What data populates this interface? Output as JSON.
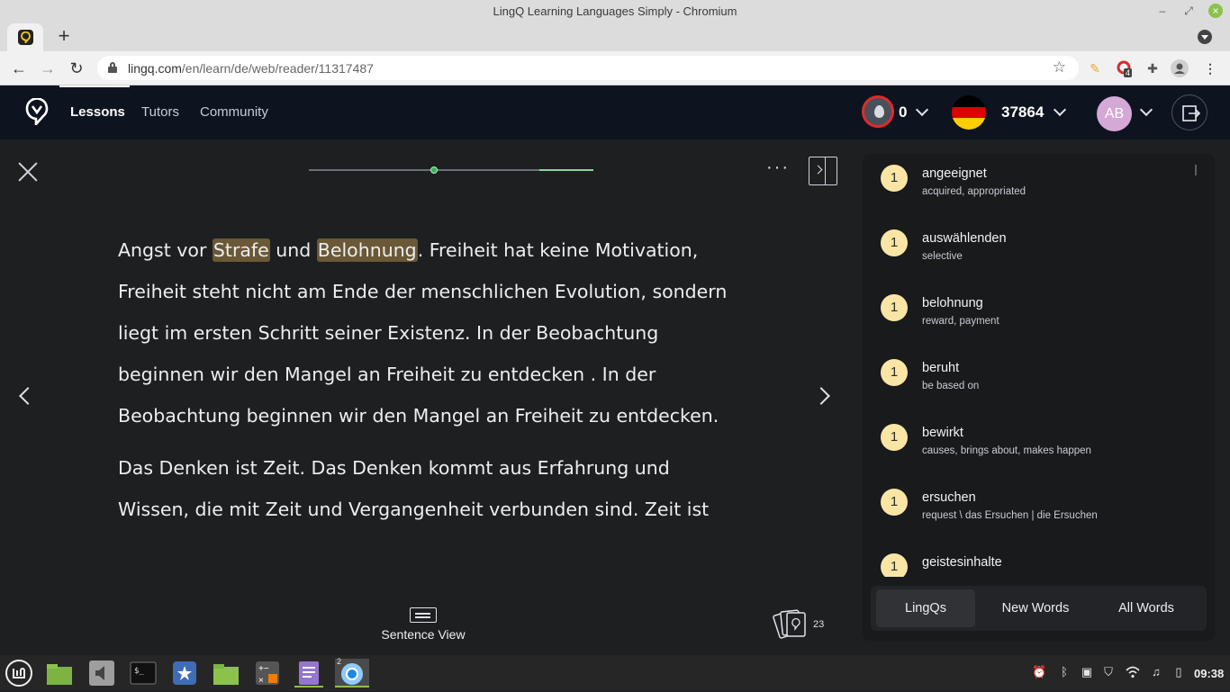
{
  "window": {
    "title": "LingQ Learning Languages Simply - Chromium",
    "minimize": "–",
    "maximize": "⤢",
    "close": "×"
  },
  "browser": {
    "new_tab": "+",
    "url_host": "lingq.com",
    "url_path": "/en/learn/de/web/reader/11317487",
    "ext_badge": "4"
  },
  "header": {
    "nav": [
      "Lessons",
      "Tutors",
      "Community"
    ],
    "streak": "0",
    "coins": "37864",
    "avatar_initials": "AB",
    "flag_colors": [
      "#000000",
      "#dd0000",
      "#ffce00"
    ]
  },
  "reader": {
    "progress_fraction": 0.44,
    "more": "···",
    "paragraphs": [
      [
        {
          "t": "Angst vor "
        },
        {
          "t": "Strafe",
          "lingq": true
        },
        {
          "t": " und "
        },
        {
          "t": "Belohnung",
          "lingq": true
        },
        {
          "t": ". Freiheit hat keine Motivation, Freiheit steht nicht am Ende der menschlichen Evolution, sondern liegt im ersten Schritt seiner Existenz. In der Beobachtung beginnen wir den Mangel an Freiheit zu entdecken . In der Beobachtung beginnen wir den Mangel an Freiheit zu entdecken."
        }
      ],
      [
        {
          "t": "Das Denken ist Zeit. Das Denken kommt aus Erfahrung und Wissen, die mit Zeit und Vergangenheit verbunden sind. Zeit ist"
        }
      ]
    ],
    "sentence_view_label": "Sentence View",
    "cards_count": "23"
  },
  "panel": {
    "words": [
      {
        "status": "1",
        "term": "angeeignet",
        "hint": "acquired, appropriated"
      },
      {
        "status": "1",
        "term": "auswählenden",
        "hint": "selective"
      },
      {
        "status": "1",
        "term": "belohnung",
        "hint": "reward, payment"
      },
      {
        "status": "1",
        "term": "beruht",
        "hint": "be based on"
      },
      {
        "status": "1",
        "term": "bewirkt",
        "hint": "causes, brings about, makes happen"
      },
      {
        "status": "1",
        "term": "ersuchen",
        "hint": "request \\ das Ersuchen | die Ersuchen"
      },
      {
        "status": "1",
        "term": "geistesinhalte",
        "hint": ""
      }
    ],
    "tabs": {
      "lingqs": "LingQs",
      "new_words": "New Words",
      "all_words": "All Words"
    }
  },
  "taskbar": {
    "clock": "09:38",
    "window_count": "2",
    "accent": "#8bc34a"
  }
}
